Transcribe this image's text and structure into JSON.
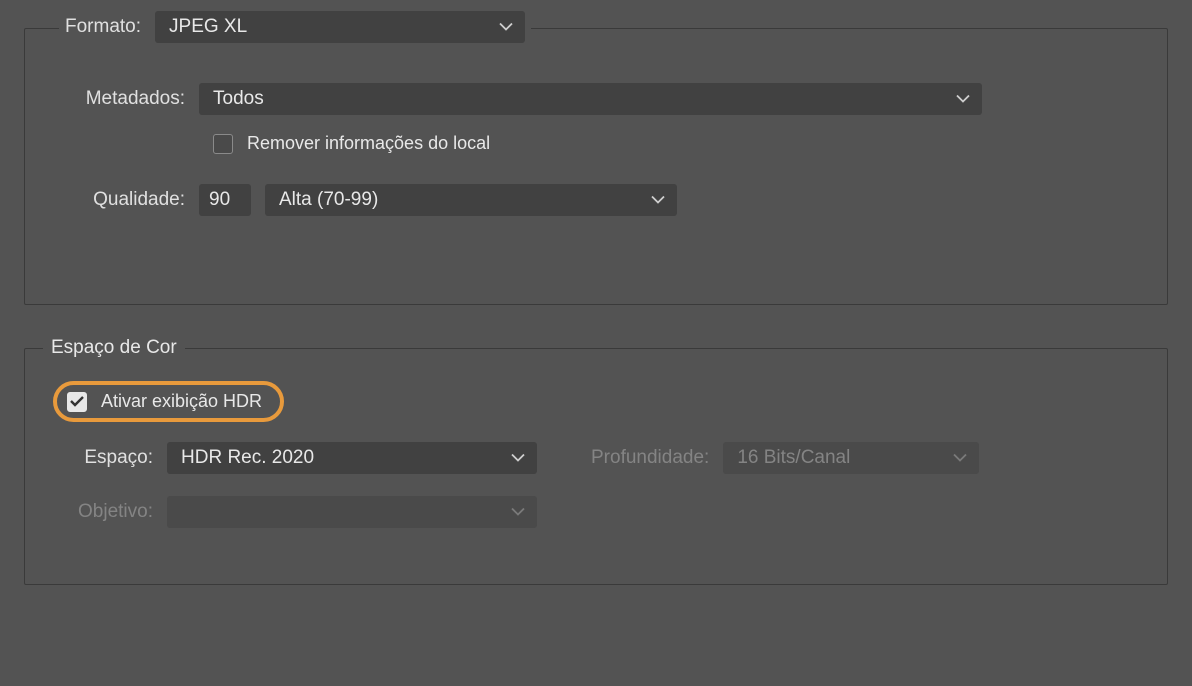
{
  "format_section": {
    "format_label": "Formato:",
    "format_value": "JPEG XL",
    "metadata_label": "Metadados:",
    "metadata_value": "Todos",
    "remove_location_label": "Remover informações do local",
    "remove_location_checked": false,
    "quality_label": "Qualidade:",
    "quality_value": "90",
    "quality_preset": "Alta (70-99)"
  },
  "color_section": {
    "legend": "Espaço de Cor",
    "hdr_enable_label": "Ativar exibição HDR",
    "hdr_enable_checked": true,
    "space_label": "Espaço:",
    "space_value": "HDR Rec. 2020",
    "depth_label": "Profundidade:",
    "depth_value": "16 Bits/Canal",
    "intent_label": "Objetivo:",
    "intent_value": ""
  }
}
